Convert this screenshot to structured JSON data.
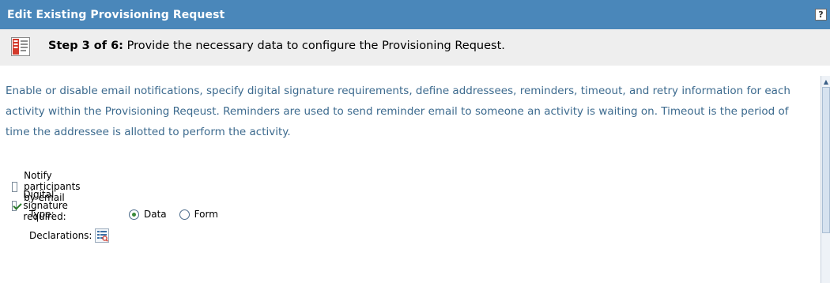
{
  "header": {
    "title": "Edit Existing Provisioning Request",
    "help_label": "?"
  },
  "step": {
    "label": "Step 3 of 6:",
    "text": "Provide the necessary data to configure the Provisioning Request.",
    "icon": "form-steps-icon"
  },
  "description": "Enable or disable email notifications, specify digital signature requirements, define addressees, reminders, timeout, and retry information for each activity within the Provisioning Reqeust.  Reminders are used to send reminder email to someone an activity is waiting on.  Timeout is the period of time the addressee is allotted to perform the activity.",
  "form": {
    "notify": {
      "label": "Notify participants by email",
      "checked": false
    },
    "signature": {
      "label": "Digital signature required:",
      "checked": true
    },
    "type_label": "Type:",
    "type_options": [
      {
        "label": "Data",
        "selected": true
      },
      {
        "label": "Form",
        "selected": false
      }
    ],
    "declarations_label": "Declarations:",
    "declarations_icon": "declarations-icon"
  },
  "colors": {
    "header_bg": "#4a87ba",
    "step_bg": "#eeeeee",
    "description_text": "#3c6a8e"
  }
}
